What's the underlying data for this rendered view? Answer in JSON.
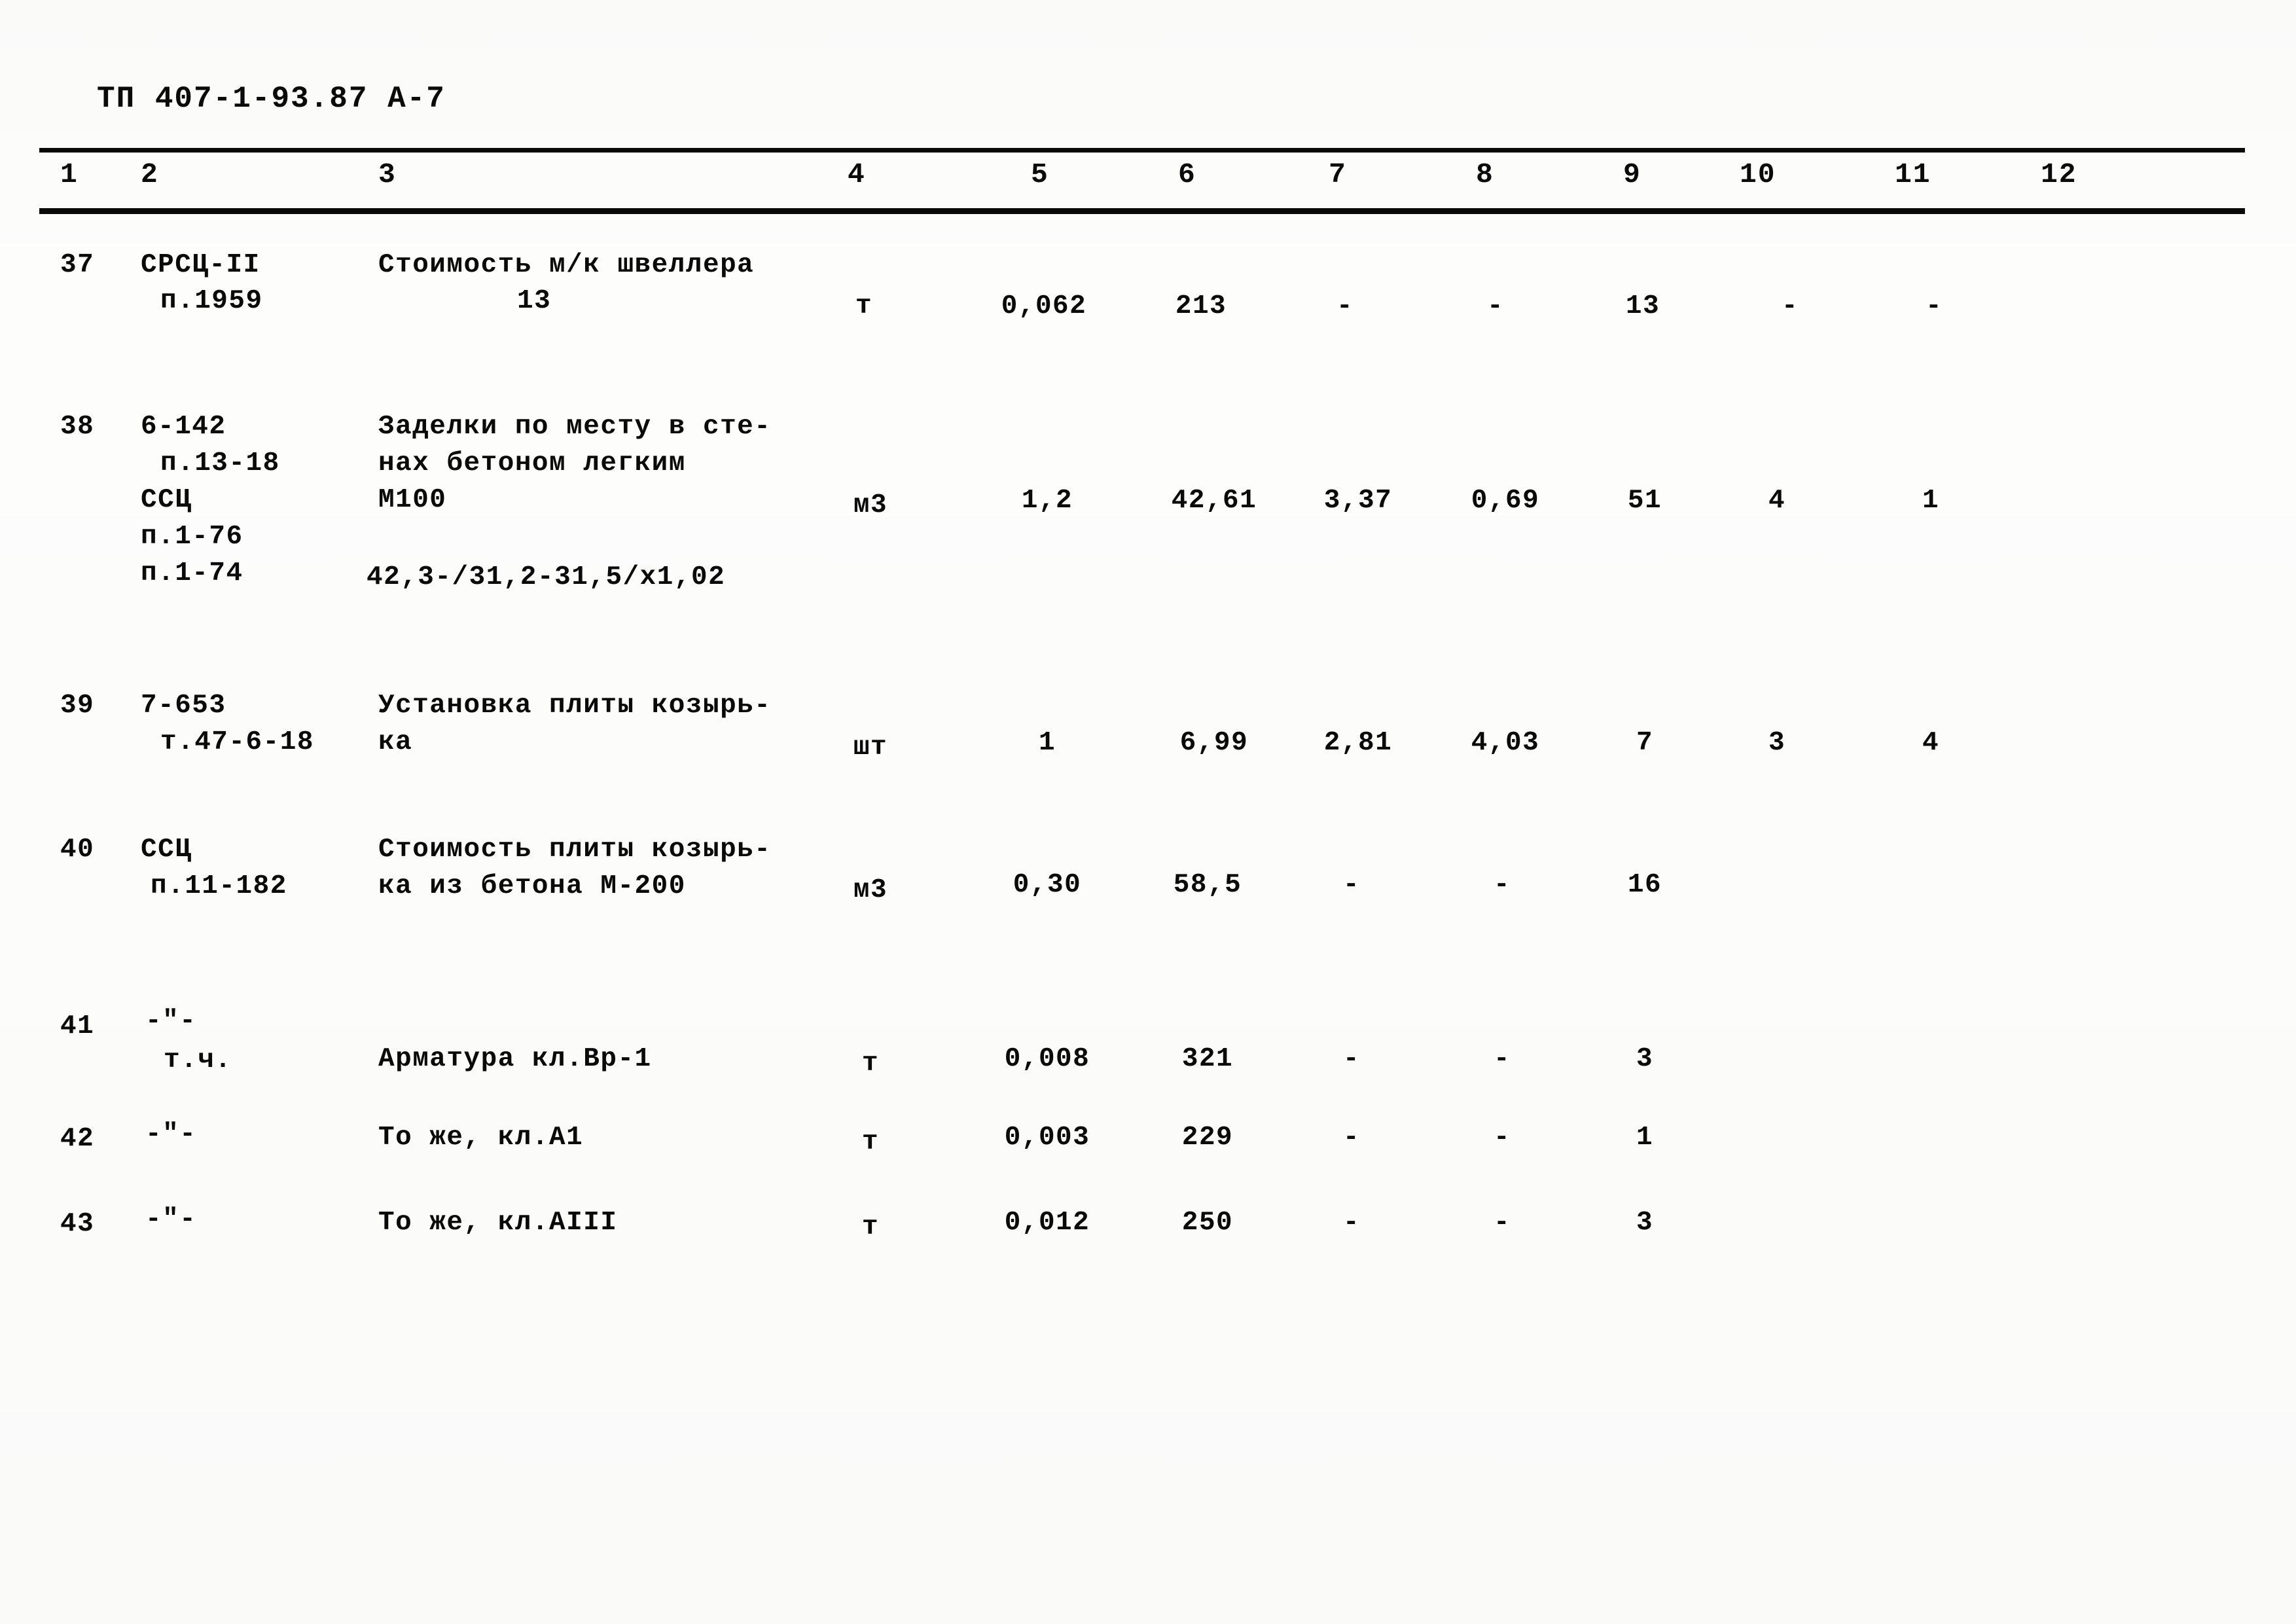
{
  "document": {
    "code": "ТП 407-1-93.87 А-7"
  },
  "table": {
    "column_headers": [
      "1",
      "2",
      "3",
      "4",
      "5",
      "6",
      "7",
      "8",
      "9",
      "10",
      "11",
      "12"
    ],
    "rows": [
      {
        "num": "37",
        "ref_lines": [
          "СРСЦ-II",
          "п.1959"
        ],
        "desc_lines": [
          "Стоимость м/к швеллера",
          "13"
        ],
        "unit": "т",
        "c5": "0,062",
        "c6": "213",
        "c7": "-",
        "c8": "-",
        "c9": "13",
        "c10": "-",
        "c11": "-",
        "c12": ""
      },
      {
        "num": "38",
        "ref_lines": [
          "6-142",
          "п.13-18",
          "ССЦ",
          "п.1-76",
          "п.1-74"
        ],
        "desc_lines": [
          "Заделки по месту в сте-",
          "нах бетоном легким",
          "М100"
        ],
        "desc_formula": "42,3-/31,2-31,5/х1,02",
        "unit": "м3",
        "c5": "1,2",
        "c6": "42,61",
        "c7": "3,37",
        "c8": "0,69",
        "c9": "51",
        "c10": "4",
        "c11": "1",
        "c12": ""
      },
      {
        "num": "39",
        "ref_lines": [
          "7-653",
          "т.47-6-18"
        ],
        "desc_lines": [
          "Установка плиты козырь-",
          "ка"
        ],
        "unit": "шт",
        "c5": "1",
        "c6": "6,99",
        "c7": "2,81",
        "c8": "4,03",
        "c9": "7",
        "c10": "3",
        "c11": "4",
        "c12": ""
      },
      {
        "num": "40",
        "ref_lines": [
          "ССЦ",
          "п.11-182"
        ],
        "desc_lines": [
          "Стоимость плиты козырь-",
          "ка из бетона М-200"
        ],
        "unit": "м3",
        "c5": "0,30",
        "c6": "58,5",
        "c7": "-",
        "c8": "-",
        "c9": "16",
        "c10": "",
        "c11": "",
        "c12": ""
      },
      {
        "num": "41",
        "ref_lines": [
          "-\"-",
          "т.ч."
        ],
        "desc_lines": [
          "Арматура кл.Вр-1"
        ],
        "unit": "т",
        "c5": "0,008",
        "c6": "321",
        "c7": "-",
        "c8": "-",
        "c9": "3",
        "c10": "",
        "c11": "",
        "c12": ""
      },
      {
        "num": "42",
        "ref_lines": [
          "-\"-"
        ],
        "desc_lines": [
          "То же, кл.А1"
        ],
        "unit": "т",
        "c5": "0,003",
        "c6": "229",
        "c7": "-",
        "c8": "-",
        "c9": "1",
        "c10": "",
        "c11": "",
        "c12": ""
      },
      {
        "num": "43",
        "ref_lines": [
          "-\"-"
        ],
        "desc_lines": [
          "То же, кл.АIII"
        ],
        "unit": "т",
        "c5": "0,012",
        "c6": "250",
        "c7": "-",
        "c8": "-",
        "c9": "3",
        "c10": "",
        "c11": "",
        "c12": ""
      }
    ]
  }
}
